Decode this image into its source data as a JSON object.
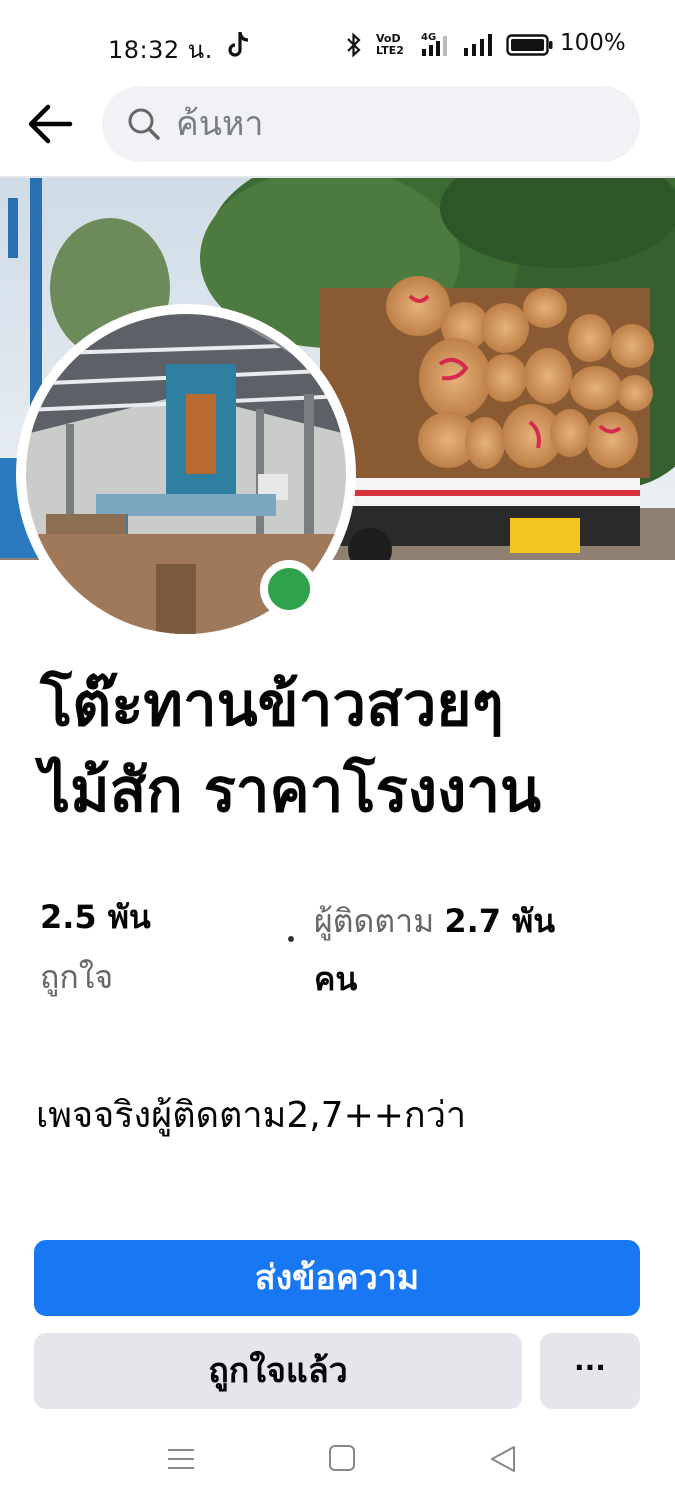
{
  "status_bar": {
    "time": "18:32 น.",
    "volte_line1": "VoD",
    "volte_line2": "LTE2",
    "network": "4G",
    "battery": "100%",
    "icons": [
      "tiktok-icon",
      "bluetooth-icon",
      "volte-icon",
      "signal-4g-icon",
      "signal-icon",
      "battery-icon"
    ]
  },
  "search": {
    "placeholder": "ค้นหา",
    "icon": "search-icon",
    "back_icon": "back-arrow-icon"
  },
  "page": {
    "name_line1": "โต๊ะทานข้าวสวยๆ",
    "name_line2": "ไม้สัก ราคาโรงงาน",
    "likes_count": "2.5 พัน",
    "likes_label": "ถูกใจ",
    "followers_label": "ผู้ติดตาม",
    "followers_count": "2.7 พัน",
    "followers_unit": "คน",
    "bio": "เพจจริงผู้ติดตาม2,7++กว่า",
    "online": true
  },
  "buttons": {
    "message": "ส่งข้อความ",
    "liked": "ถูกใจแล้ว",
    "more": "···"
  },
  "colors": {
    "primary": "#1877f2",
    "secondary_button": "#e4e6eb",
    "search_bg": "#f0f2f5",
    "muted_text": "#65676b",
    "online": "#31a24c"
  }
}
